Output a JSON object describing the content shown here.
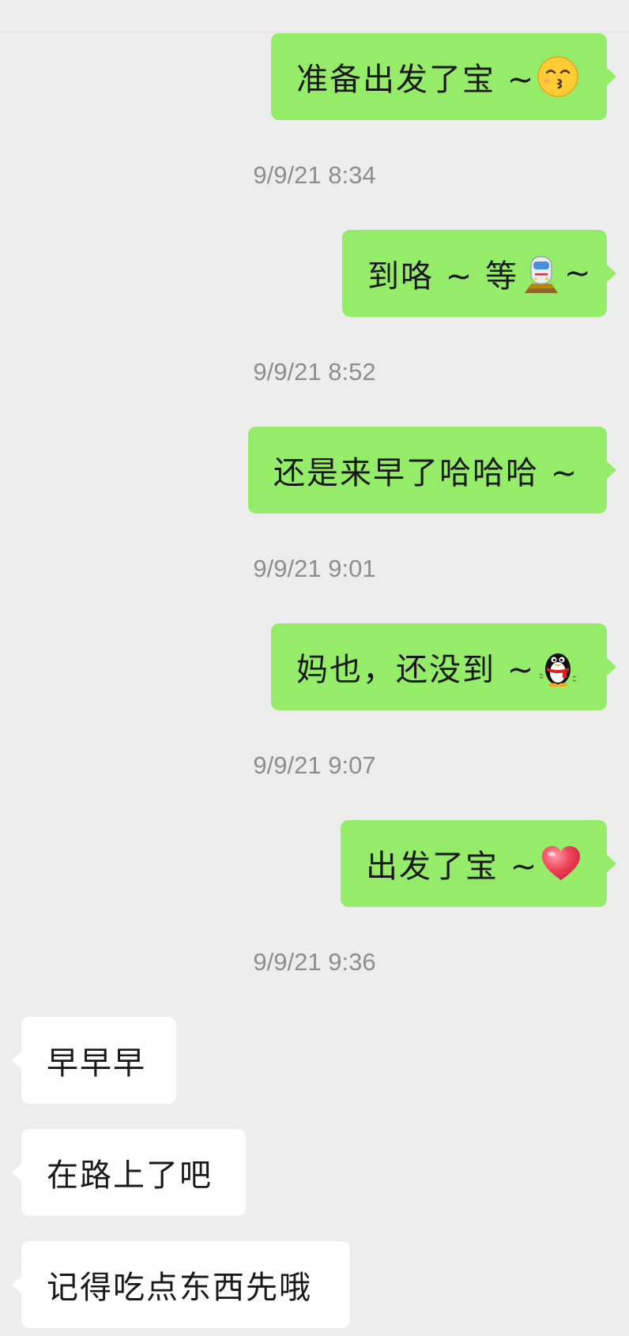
{
  "messages": [
    {
      "direction": "out",
      "parts": [
        "准备出发了宝 ~",
        "kissing-face-icon"
      ]
    },
    {
      "timestamp": "9/9/21 8:34"
    },
    {
      "direction": "out",
      "parts": [
        "到咯 ~ 等",
        "train-icon",
        " ~"
      ]
    },
    {
      "timestamp": "9/9/21 8:52"
    },
    {
      "direction": "out",
      "parts": [
        "还是来早了哈哈哈 ~"
      ]
    },
    {
      "timestamp": "9/9/21 9:01"
    },
    {
      "direction": "out",
      "parts": [
        "妈也，还没到 ~",
        "penguin-icon"
      ]
    },
    {
      "timestamp": "9/9/21 9:07"
    },
    {
      "direction": "out",
      "parts": [
        "出发了宝 ~",
        "heart-icon"
      ]
    },
    {
      "timestamp": "9/9/21 9:36"
    },
    {
      "direction": "in",
      "parts": [
        "早早早"
      ]
    },
    {
      "direction": "in",
      "parts": [
        "在路上了吧"
      ]
    },
    {
      "direction": "in",
      "parts": [
        "记得吃点东西先哦"
      ]
    }
  ],
  "m": {
    "m1": "准备出发了宝 ~",
    "t1": "9/9/21 8:34",
    "m2a": "到咯 ~ 等",
    "m2b": " ~",
    "t2": "9/9/21 8:52",
    "m3": "还是来早了哈哈哈 ~",
    "t3": "9/9/21 9:01",
    "m4": "妈也，还没到 ~",
    "t4": "9/9/21 9:07",
    "m5": "出发了宝 ~",
    "t5": "9/9/21 9:36",
    "m6": "早早早",
    "m7": "在路上了吧",
    "m8": "记得吃点东西先哦"
  },
  "colors": {
    "background": "#ededed",
    "outgoing_bubble": "#95ec69",
    "incoming_bubble": "#ffffff",
    "timestamp_text": "#8e8e8e"
  }
}
